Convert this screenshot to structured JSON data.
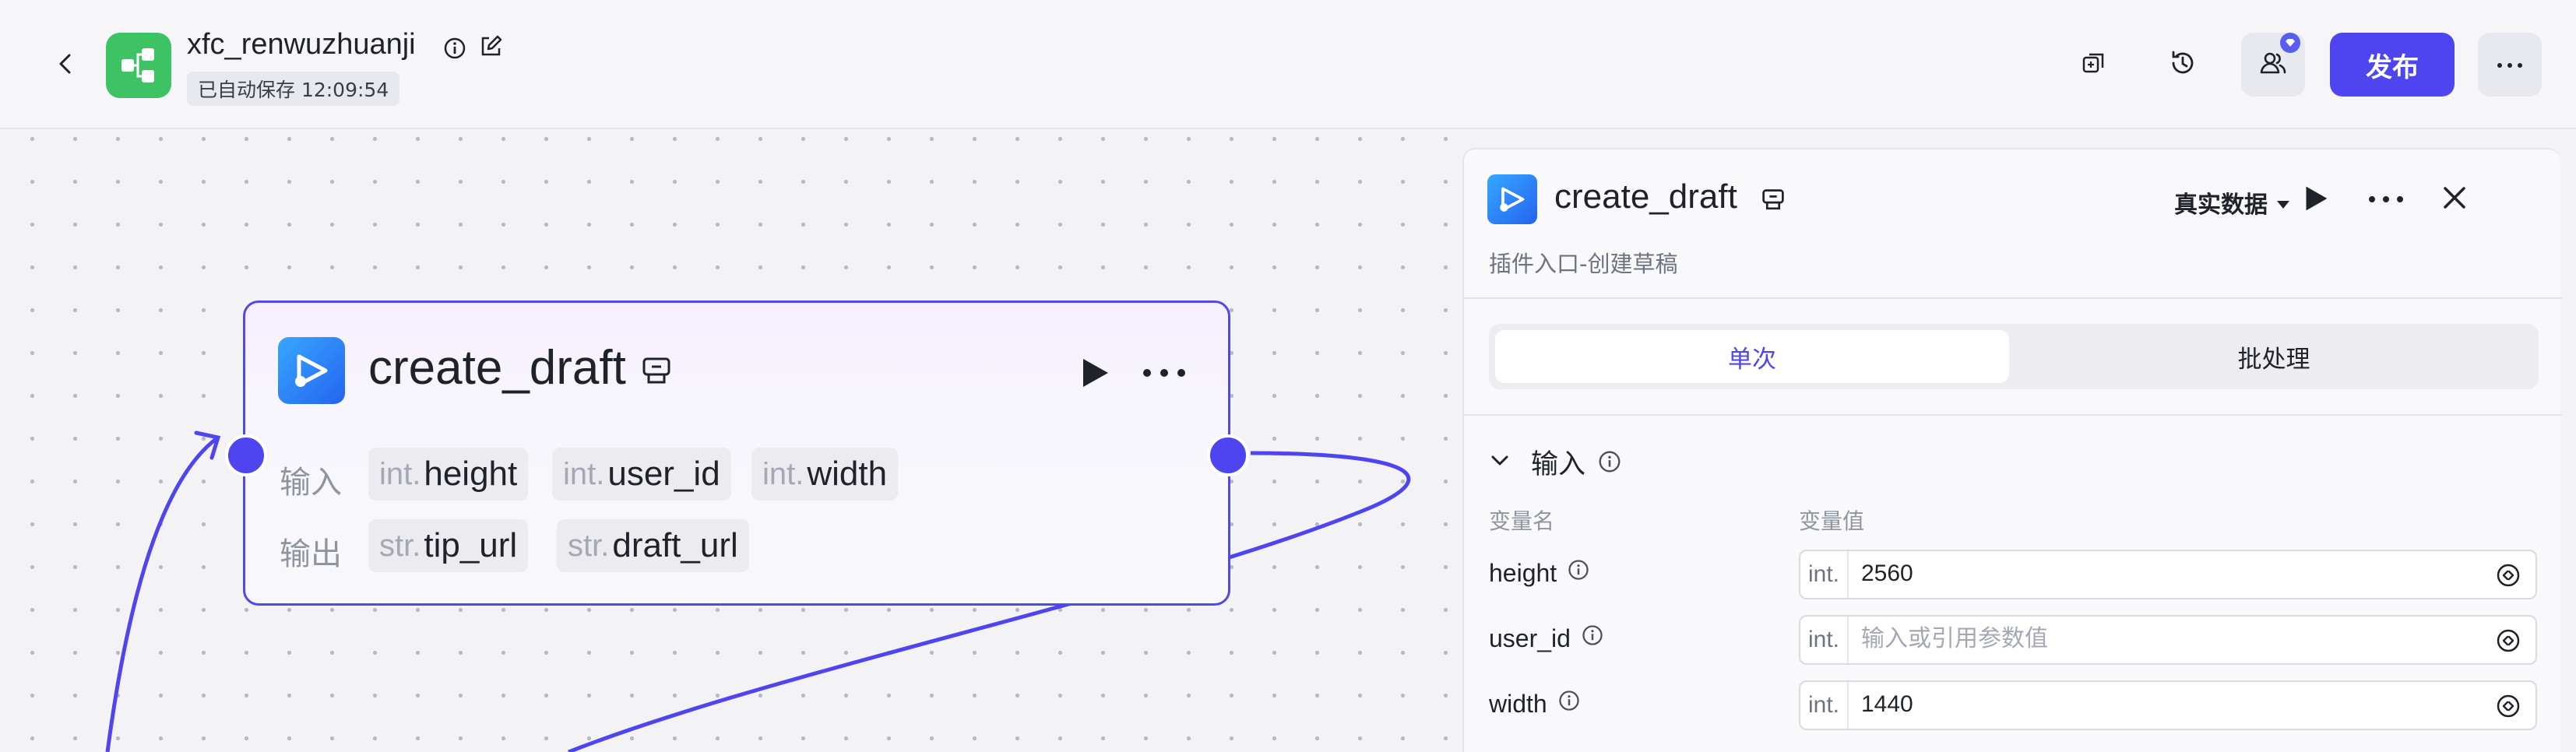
{
  "header": {
    "app_name": "xfc_renwuzhuanji",
    "autosave": "已自动保存 12:09:54",
    "publish_label": "发布"
  },
  "node": {
    "title": "create_draft",
    "input_label": "输入",
    "output_label": "输出",
    "inputs": [
      {
        "type": "int.",
        "name": "height"
      },
      {
        "type": "int.",
        "name": "user_id"
      },
      {
        "type": "int.",
        "name": "width"
      }
    ],
    "outputs": [
      {
        "type": "str.",
        "name": "tip_url"
      },
      {
        "type": "str.",
        "name": "draft_url"
      }
    ]
  },
  "panel": {
    "title": "create_draft",
    "description": "插件入口-创建草稿",
    "mode": "真实数据",
    "tabs": [
      "单次",
      "批处理"
    ],
    "section_title": "输入",
    "col_name": "变量名",
    "col_value": "变量值",
    "variables": [
      {
        "name": "height",
        "type": "int.",
        "value": "2560",
        "placeholder": "输入或引用参数值"
      },
      {
        "name": "user_id",
        "type": "int.",
        "value": "",
        "placeholder": "输入或引用参数值"
      },
      {
        "name": "width",
        "type": "int.",
        "value": "1440",
        "placeholder": "输入或引用参数值"
      }
    ]
  },
  "colors": {
    "accent": "#4f45f0",
    "logo_green": "#3ec364",
    "edge": "#4f45f0"
  },
  "icons": [
    "back-arrow-icon",
    "workflow-logo-icon",
    "info-icon",
    "edit-icon",
    "copy-icon",
    "history-icon",
    "collaborator-icon",
    "more-icon",
    "plugin-icon",
    "plugin-badge-icon",
    "play-icon",
    "close-icon",
    "chevron-down-icon",
    "reference-icon"
  ]
}
